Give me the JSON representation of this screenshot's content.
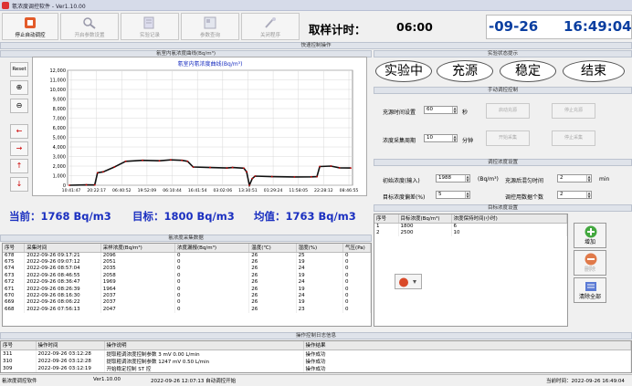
{
  "window": {
    "title": "氡浓度调控软件 - Ver1.10.00"
  },
  "toolbar": {
    "buttons": [
      {
        "label": "停止自动调控",
        "icon": "stop-icon",
        "active": true
      },
      {
        "label": "开启参数设置",
        "icon": "search-icon",
        "active": false
      },
      {
        "label": "实验记录",
        "icon": "record-icon",
        "active": false
      },
      {
        "label": "参数查询",
        "icon": "query-icon",
        "active": false
      },
      {
        "label": "关闭程序",
        "icon": "exit-icon",
        "active": false
      }
    ]
  },
  "header": {
    "timer_label": "取样计时：",
    "timer_value": "06:00",
    "date_partial": "-09-26",
    "clock": "16:49:04"
  },
  "quick": {
    "title": "快速控制操作"
  },
  "chart_panel": {
    "title": "氡室内氡浓度曲线(Bq/m³)",
    "reset": "Reset",
    "zoom_in": "⊕",
    "zoom_out": "⊖",
    "left": "←",
    "right": "→",
    "up": "↑",
    "down": "↓"
  },
  "chart_data": {
    "type": "line",
    "title": "氡室内氡浓度曲线(Bq/m³)",
    "ylim": [
      0,
      12000
    ],
    "y_ticks": [
      "12,000",
      "11,000",
      "10,000",
      "9,000",
      "8,000",
      "7,000",
      "6,000",
      "5,000",
      "4,000",
      "3,000",
      "2,000",
      "1,000",
      "0"
    ],
    "x_ticks": [
      "10:41:47",
      "20:22:17",
      "06:40:52",
      "19:52:09",
      "06:10:44",
      "16:41:54",
      "03:02:06",
      "13:30:51",
      "01:29:24",
      "11:58:05",
      "22:28:12",
      "08:46:55"
    ],
    "series": [
      {
        "values": [
          [
            0,
            0
          ],
          [
            0.06,
            40
          ],
          [
            0.09,
            30
          ],
          [
            0.1,
            1300
          ],
          [
            0.12,
            1400
          ],
          [
            0.16,
            1900
          ],
          [
            0.2,
            2500
          ],
          [
            0.26,
            2600
          ],
          [
            0.32,
            2550
          ],
          [
            0.36,
            2650
          ],
          [
            0.4,
            2600
          ],
          [
            0.42,
            2500
          ],
          [
            0.44,
            1900
          ],
          [
            0.5,
            1850
          ],
          [
            0.56,
            1800
          ],
          [
            0.58,
            1850
          ],
          [
            0.62,
            1780
          ],
          [
            0.63,
            1400
          ],
          [
            0.64,
            0
          ],
          [
            0.65,
            700
          ],
          [
            0.66,
            950
          ],
          [
            0.72,
            900
          ],
          [
            0.8,
            870
          ],
          [
            0.86,
            880
          ],
          [
            0.88,
            900
          ],
          [
            0.89,
            1950
          ],
          [
            0.93,
            2000
          ],
          [
            0.96,
            1820
          ],
          [
            1.0,
            1800
          ]
        ]
      }
    ]
  },
  "stats": {
    "current": "当前：1768 Bq/m3",
    "target": "目标：1800 Bq/m3",
    "mean": "均值：1763 Bq/m3"
  },
  "data_table": {
    "title": "氡浓度采集数据",
    "headers": [
      "序号",
      "采集时间",
      "采样浓度(Bq/m³)",
      "浓度漏报(Bq/m³)",
      "温度(℃)",
      "湿度(%)",
      "气压(Pa)"
    ],
    "rows": [
      [
        "678",
        "2022-09-26 09:17:21",
        "2096",
        "0",
        "26",
        "25",
        "0"
      ],
      [
        "675",
        "2022-09-26 09:07:12",
        "2051",
        "0",
        "26",
        "19",
        "0"
      ],
      [
        "674",
        "2022-09-26 08:57:04",
        "2035",
        "0",
        "26",
        "24",
        "0"
      ],
      [
        "673",
        "2022-09-26 08:46:55",
        "2058",
        "0",
        "26",
        "19",
        "0"
      ],
      [
        "672",
        "2022-09-26 08:36:47",
        "1969",
        "0",
        "26",
        "24",
        "0"
      ],
      [
        "671",
        "2022-09-26 08:26:39",
        "1964",
        "0",
        "26",
        "19",
        "0"
      ],
      [
        "670",
        "2022-09-26 08:16:30",
        "2037",
        "0",
        "26",
        "24",
        "0"
      ],
      [
        "669",
        "2022-09-26 08:06:22",
        "2037",
        "0",
        "26",
        "19",
        "0"
      ],
      [
        "668",
        "2022-09-26 07:56:13",
        "2047",
        "0",
        "26",
        "23",
        "0"
      ]
    ]
  },
  "status_panel": {
    "title": "实验状态提示",
    "states": [
      "实验中",
      "充源",
      "稳定",
      "结束"
    ]
  },
  "manual": {
    "title": "手动调控控制",
    "fill_label": "充源时间设置",
    "fill_value": "60",
    "fill_unit": "秒",
    "sample_label": "浓度采集周期",
    "sample_value": "10",
    "sample_unit": "分钟",
    "btns": [
      "启动充源",
      "停止充源",
      "开始采集",
      "停止采集"
    ]
  },
  "conc": {
    "title": "调控浓度设置",
    "init_label": "初始浓度(输入)",
    "init_value": "1988",
    "init_unit": "(Bq/m³)",
    "wait_label": "充源后混匀时间",
    "wait_value": "2",
    "wait_unit": "min",
    "dev_label": "目标浓度偏差(%)",
    "dev_value": "5",
    "count_label": "调控用数据个数",
    "count_value": "2"
  },
  "target": {
    "title": "目标浓度设置",
    "headers": [
      "序号",
      "目标浓度(Bq/m³)",
      "浓度保持时间(小时)"
    ],
    "rows": [
      [
        "1",
        "1800",
        "6"
      ],
      [
        "2",
        "2500",
        "10"
      ]
    ],
    "add": "增加",
    "del": "删除",
    "clear": "清除全部"
  },
  "log": {
    "title": "操作控制日志信息",
    "headers": [
      "序号",
      "操作时间",
      "操作说明",
      "操作结果"
    ],
    "rows": [
      [
        "311",
        "2022-09-26 03:12:28",
        "提取粗调浓度控制参数 3 mV  0.00  L/min",
        "操作成功"
      ],
      [
        "310",
        "2022-09-26 03:12:28",
        "提取粗调浓度控制参数 1247 mV  0.50  L/min",
        "操作成功"
      ],
      [
        "309",
        "2022-09-26 03:12:19",
        "开始稳定控制 ST 控",
        "操作成功"
      ]
    ]
  },
  "statusbar": {
    "app": "氡浓度调控软件",
    "ver": "Ver1.10.00",
    "started": "2022-09-26 12:07:13  自动调控开始",
    "now": "当前时间：2022-09-26  16:49:04"
  }
}
